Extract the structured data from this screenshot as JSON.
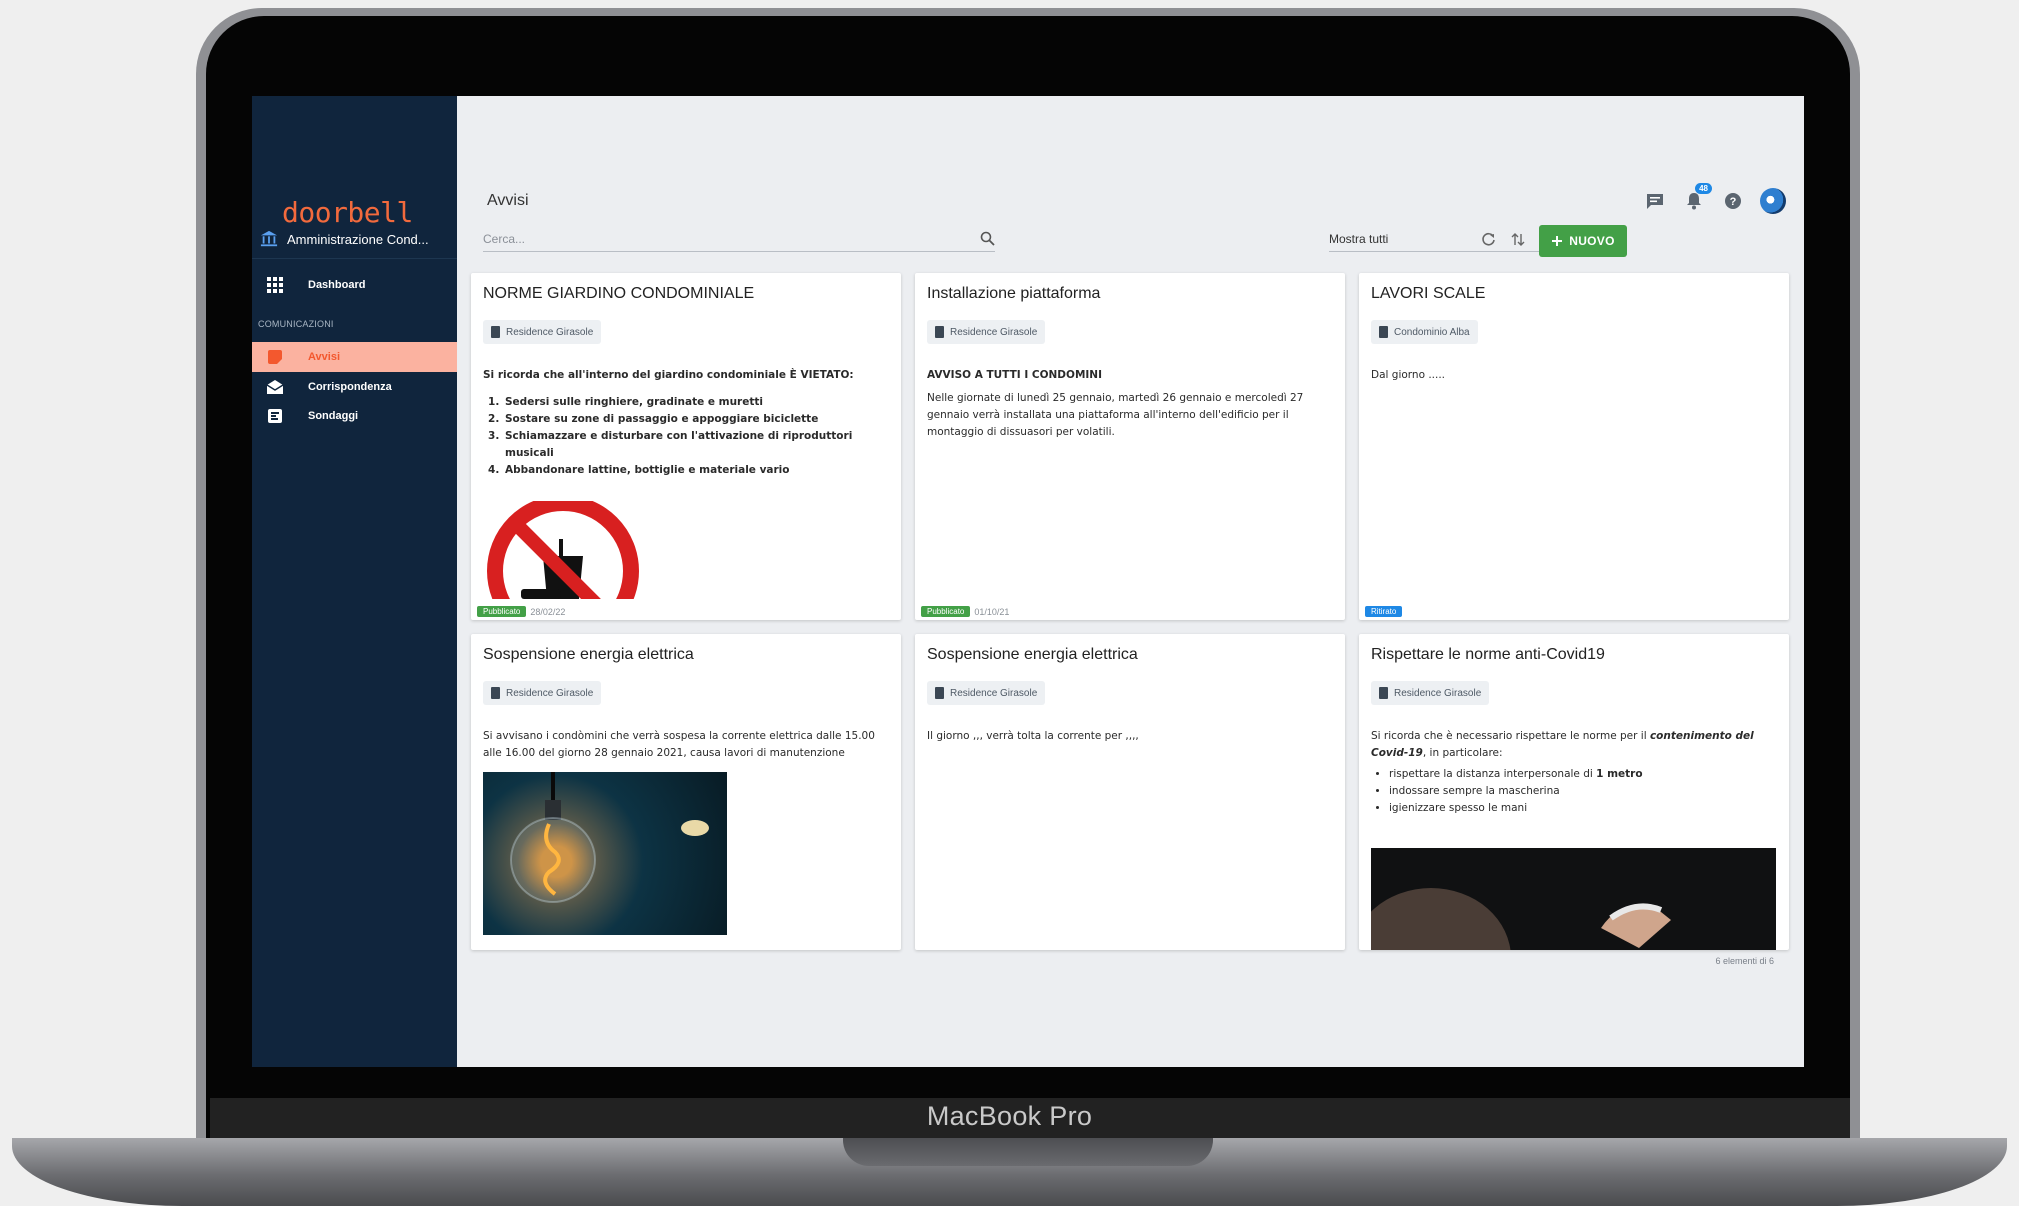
{
  "device": {
    "label": "MacBook Pro"
  },
  "app": {
    "logo": "doorbell",
    "organization": "Amministrazione Cond..."
  },
  "sidebar": {
    "section_label": "COMUNICAZIONI",
    "items": [
      {
        "label": "Dashboard",
        "icon": "grid-icon"
      },
      {
        "label": "Avvisi",
        "icon": "notice-icon",
        "active": true
      },
      {
        "label": "Corrispondenza",
        "icon": "envelope-icon"
      },
      {
        "label": "Sondaggi",
        "icon": "poll-icon"
      }
    ]
  },
  "header": {
    "title": "Avvisi",
    "notifications_count": "48",
    "search_placeholder": "Cerca...",
    "filter_value": "Mostra tutti",
    "new_button_label": "NUOVO"
  },
  "colors": {
    "sidebar": "#10253d",
    "accent": "#f3582e",
    "active_bg": "#fbb2a0",
    "new_button": "#43a047",
    "published": "#43a047",
    "withdrawn": "#1e88e5"
  },
  "cards": [
    {
      "title": "NORME GIARDINO CONDOMINIALE",
      "building": "Residence Girasole",
      "intro": "Si ricorda che all'interno del giardino condominiale È VIETATO:",
      "list": [
        "Sedersi sulle ringhiere, gradinate e muretti",
        "Sostare su zone di passaggio e appoggiare biciclette",
        "Schiamazzare e disturbare con l'attivazione di riproduttori musicali",
        "Abbandonare lattine, bottiglie e materiale vario"
      ],
      "status": "Pubblicato",
      "date": "28/02/22"
    },
    {
      "title": "Installazione piattaforma",
      "building": "Residence Girasole",
      "heading": "AVVISO A TUTTI I CONDOMINI",
      "text": "Nelle giornate di lunedì 25 gennaio, martedì 26 gennaio e mercoledì 27 gennaio verrà installata una piattaforma all'interno dell'edificio per il montaggio di dissuasori per volatili.",
      "status": "Pubblicato",
      "date": "01/10/21"
    },
    {
      "title": "LAVORI SCALE",
      "building": "Condominio Alba",
      "text": "Dal giorno .....",
      "status": "Ritirato"
    },
    {
      "title": "Sospensione energia elettrica",
      "building": "Residence Girasole",
      "text": "Si avvisano i condòmini che verrà sospesa la corrente elettrica dalle 15.00 alle 16.00 del giorno 28 gennaio 2021, causa lavori di manutenzione"
    },
    {
      "title": "Sospensione energia elettrica",
      "building": "Residence Girasole",
      "text": "Il giorno ,,, verrà tolta la corrente per ,,,,"
    },
    {
      "title": "Rispettare le norme anti-Covid19",
      "building": "Residence Girasole",
      "text_before": "Si ricorda che è necessario rispettare le norme per il ",
      "text_emph": "contenimento del Covid-19",
      "text_after": ", in particolare:",
      "list_a_before": "rispettare la distanza interpersonale di ",
      "list_a_bold": "1 metro",
      "list_b": "indossare sempre la mascherina",
      "list_c": "igienizzare spesso le mani"
    }
  ],
  "footer": {
    "count": "6 elementi di 6"
  }
}
